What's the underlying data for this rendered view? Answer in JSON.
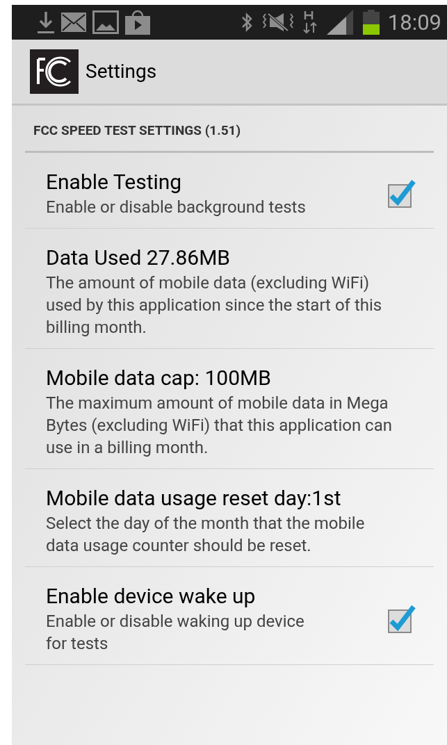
{
  "status_bar": {
    "time": "18:09"
  },
  "action_bar": {
    "title": "Settings"
  },
  "section": {
    "title": "FCC SPEED TEST SETTINGS (1.51)"
  },
  "items": [
    {
      "kind": "checkbox",
      "title": "Enable Testing",
      "summary": "Enable or disable background tests",
      "checked": true
    },
    {
      "kind": "text",
      "title": "Data Used 27.86MB",
      "summary": "The amount of mobile data (excluding WiFi) used by this application since the start of this billing month."
    },
    {
      "kind": "text",
      "title": "Mobile data cap: 100MB",
      "summary": "The maximum amount of mobile data in Mega Bytes (excluding WiFi) that this application can use in a billing month."
    },
    {
      "kind": "text",
      "title": "Mobile data usage reset day:1st",
      "summary": "Select the day of the month that the mobile data usage counter should be reset."
    },
    {
      "kind": "checkbox",
      "title": "Enable device wake up",
      "summary": "Enable or disable waking up device for tests",
      "checked": true
    }
  ]
}
